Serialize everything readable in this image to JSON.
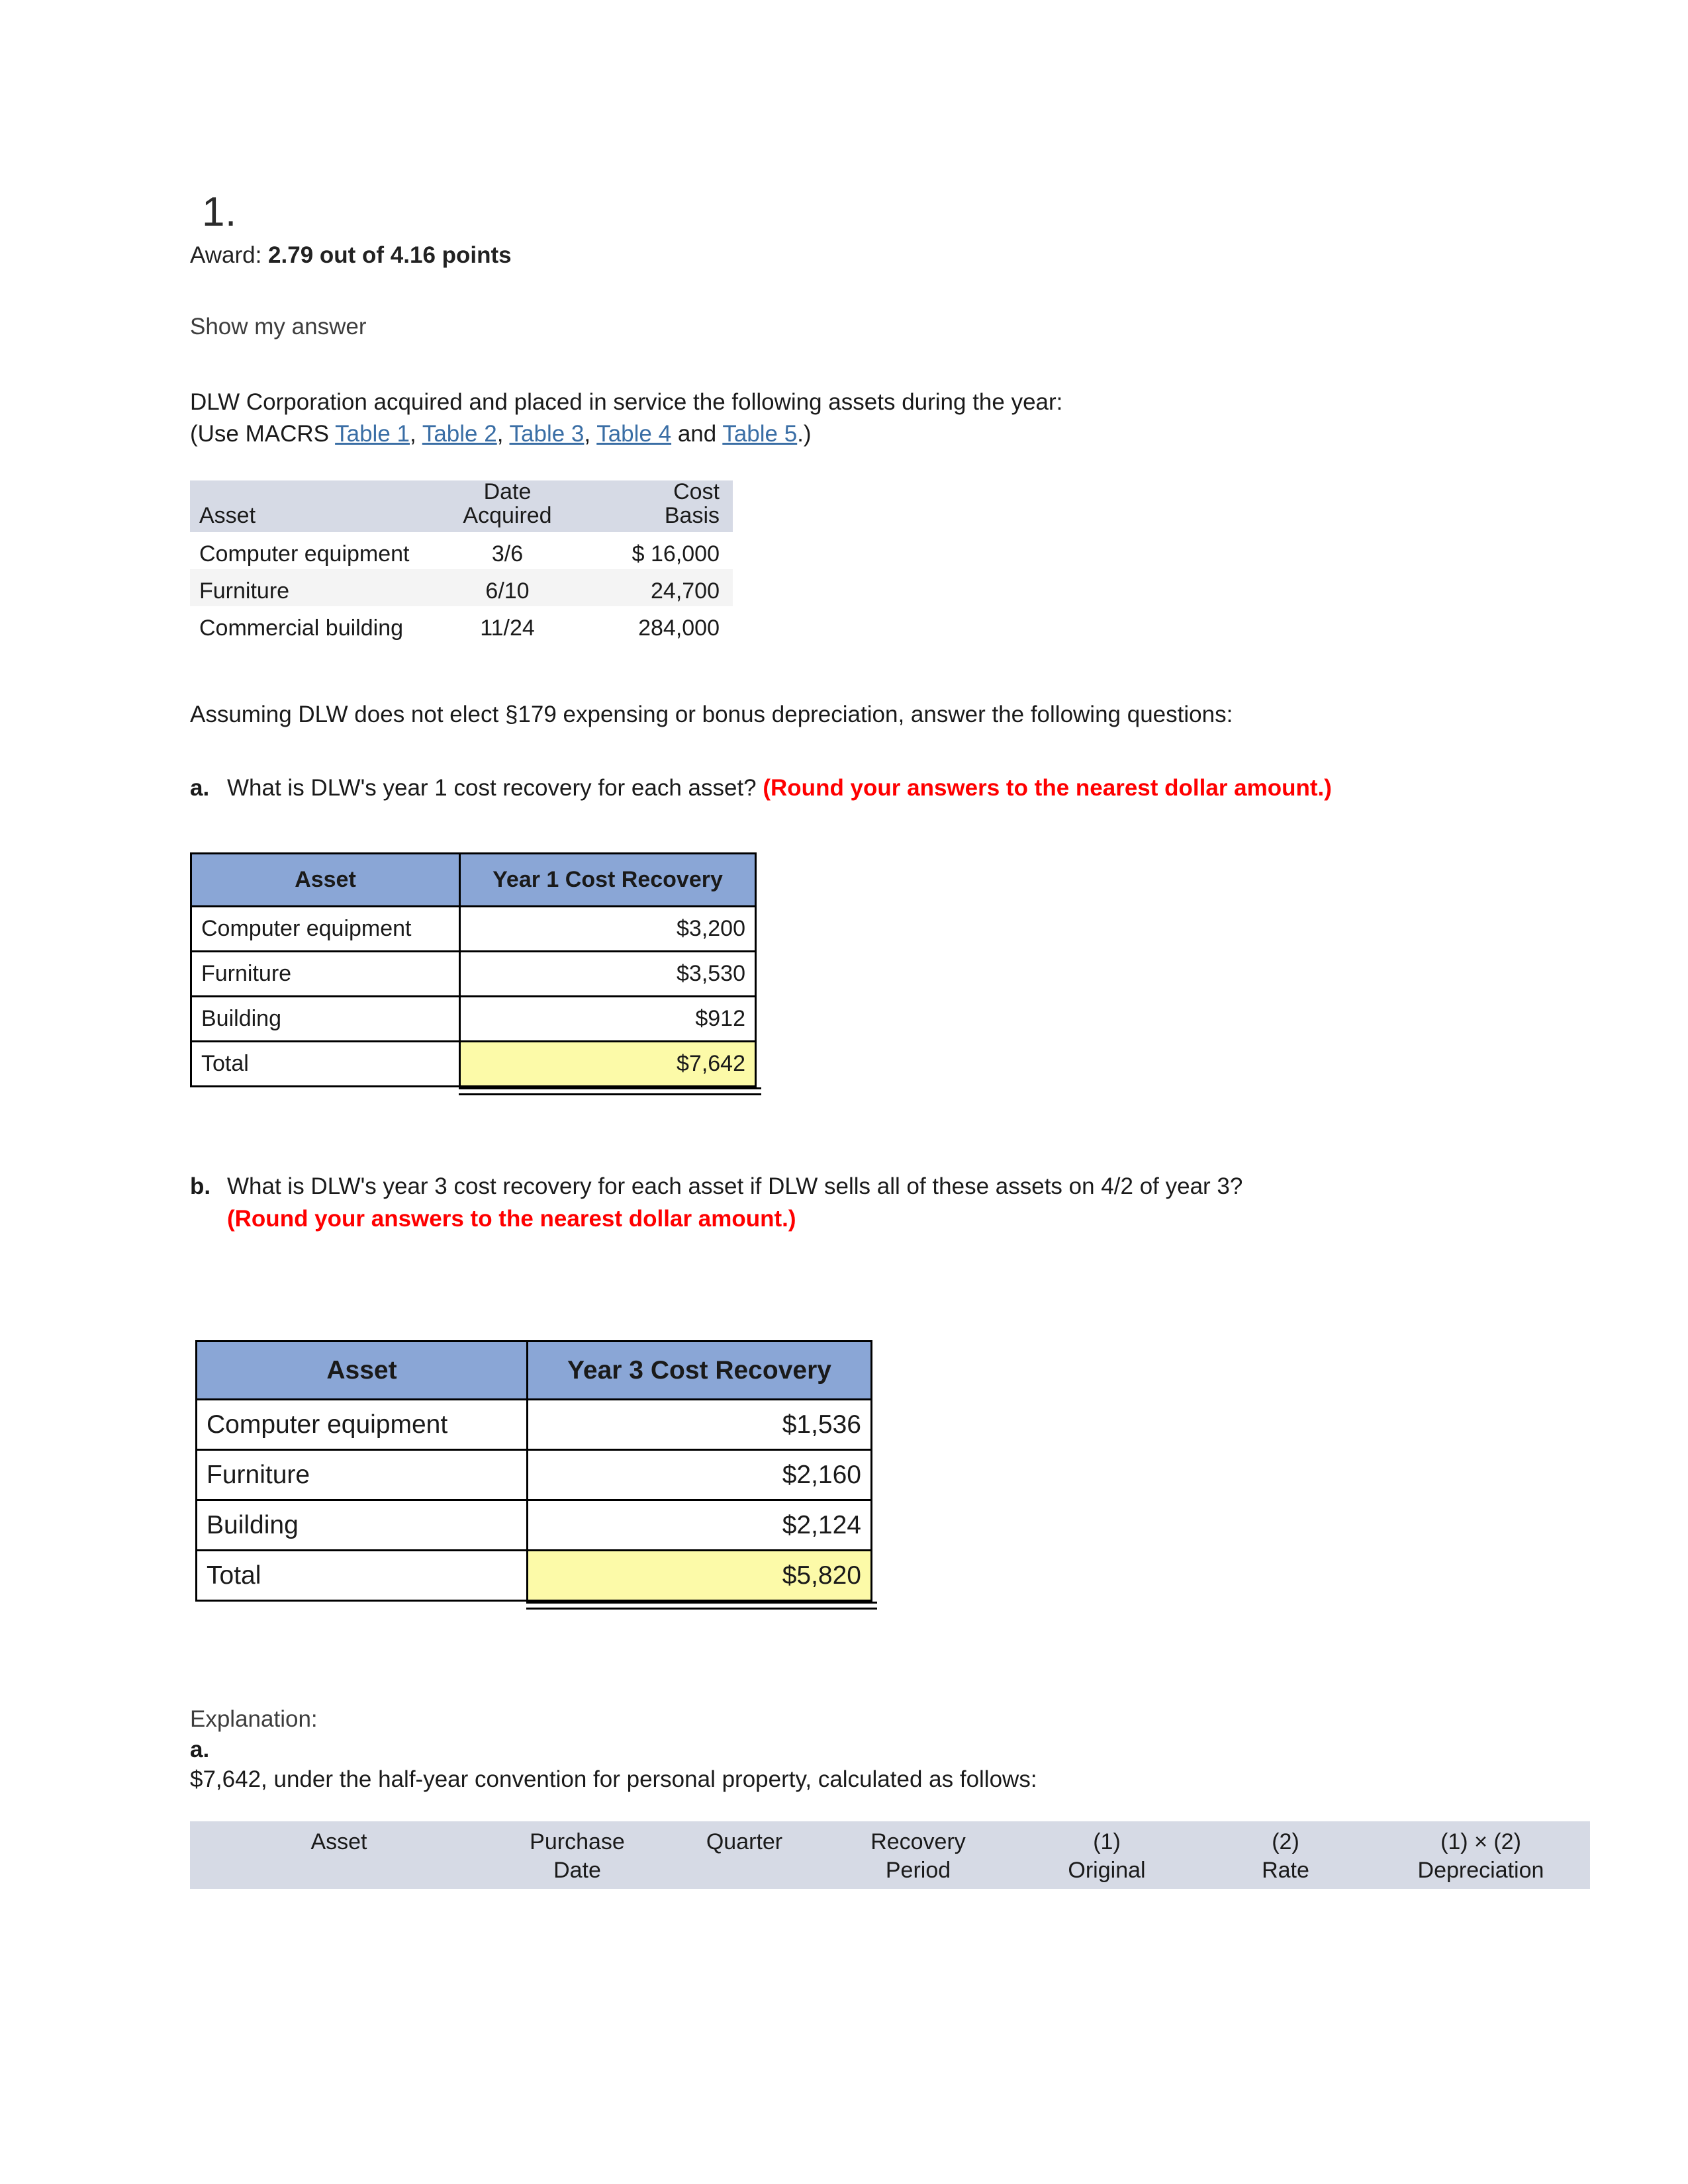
{
  "question": {
    "number": "1.",
    "award_label": "Award:",
    "award_value": "2.79 out of 4.16 points",
    "show_answer": "Show my answer"
  },
  "prompt": {
    "line1": "DLW Corporation acquired and placed in service the following assets during the year:",
    "line2_prefix": "(Use MACRS ",
    "links": [
      "Table 1",
      "Table 2",
      "Table 3",
      "Table 4",
      "Table 5"
    ],
    "sep": ", ",
    "and_word": " and ",
    "line2_suffix": ".)",
    "assumption": "Assuming DLW does not elect §179 expensing or bonus depreciation, answer the following questions:"
  },
  "asset_table": {
    "headers": {
      "asset": "Asset",
      "date_l1": "Date",
      "date_l2": "Acquired",
      "cost_l1": "Cost",
      "cost_l2": "Basis"
    },
    "rows": [
      {
        "asset": "Computer equipment",
        "date": "3/6",
        "basis": "$ 16,000"
      },
      {
        "asset": "Furniture",
        "date": "6/10",
        "basis": "24,700"
      },
      {
        "asset": "Commercial building",
        "date": "11/24",
        "basis": "284,000"
      }
    ]
  },
  "part_a": {
    "letter": "a.",
    "text": "What is DLW's year 1 cost recovery for each asset? ",
    "note": "(Round your answers to the nearest dollar amount.)",
    "table": {
      "header_asset": "Asset",
      "header_value": "Year 1 Cost Recovery",
      "rows": [
        {
          "asset": "Computer equipment",
          "value": "$3,200"
        },
        {
          "asset": "Furniture",
          "value": "$3,530"
        },
        {
          "asset": "Building",
          "value": "$912"
        }
      ],
      "total_label": "Total",
      "total_value": "$7,642"
    }
  },
  "part_b": {
    "letter": "b.",
    "text": "What is DLW's year 3 cost recovery for each asset if DLW sells all of these assets on 4/2 of year 3?",
    "note": "(Round your answers to the nearest dollar amount.)",
    "table": {
      "header_asset": "Asset",
      "header_value": "Year 3 Cost Recovery",
      "rows": [
        {
          "asset": "Computer equipment",
          "value": "$1,536"
        },
        {
          "asset": "Furniture",
          "value": "$2,160"
        },
        {
          "asset": "Building",
          "value": "$2,124"
        }
      ],
      "total_label": "Total",
      "total_value": "$5,820"
    }
  },
  "explanation": {
    "label": "Explanation:",
    "letter": "a.",
    "text": "$7,642, under the half-year convention for personal property, calculated as follows:",
    "detail_headers": {
      "asset": "Asset",
      "purchase_l1": "Purchase",
      "purchase_l2": "Date",
      "quarter": "Quarter",
      "recovery_l1": "Recovery",
      "recovery_l2": "Period",
      "one_l1": "(1)",
      "one_l2": "Original",
      "two_l1": "(2)",
      "two_l2": "Rate",
      "prod_l1": "(1) × (2)",
      "prod_l2": "Depreciation"
    }
  },
  "colors": {
    "blue_header": "#8aa6d6",
    "gray_header": "#d6dae5",
    "total_highlight": "#fcfaa8",
    "link": "#3a6ea5",
    "red_note": "#ff0000"
  }
}
